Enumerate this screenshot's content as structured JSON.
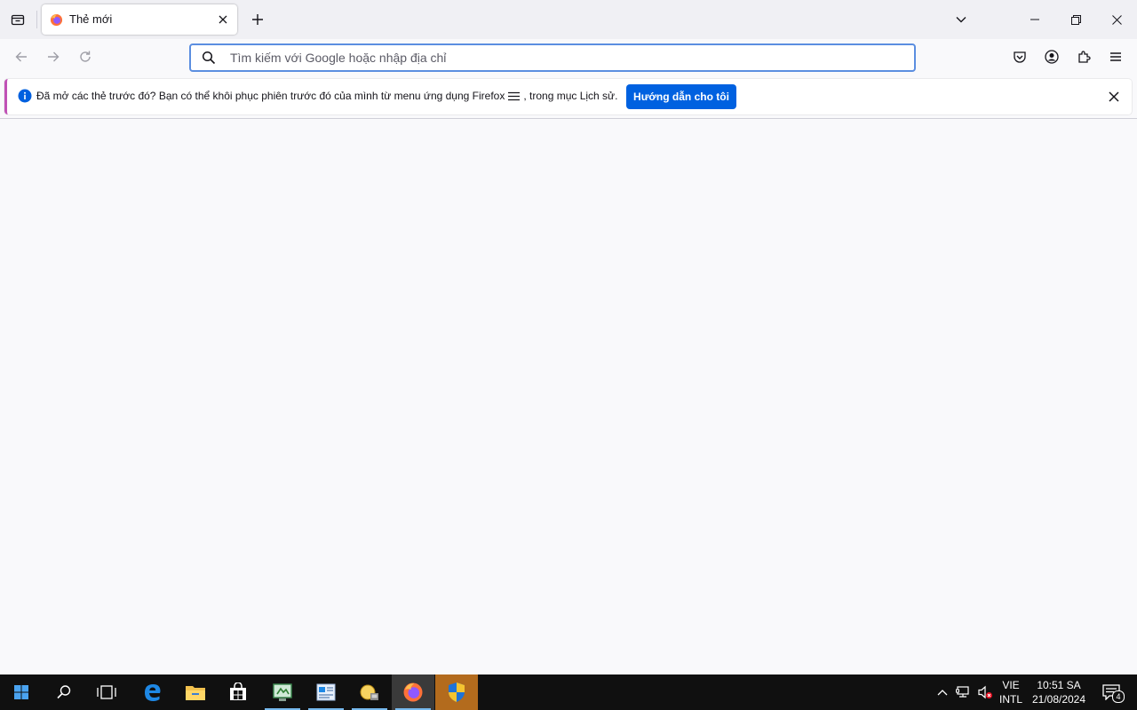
{
  "browser": {
    "tab": {
      "title": "Thẻ mới",
      "favicon": "firefox-icon"
    },
    "toolbar": {
      "tab_list_icon": "firefox-view-icon",
      "new_tab_icon": "plus-icon",
      "list_all_tabs_icon": "chevron-down-icon"
    },
    "window_controls": [
      "minimize-icon",
      "restore-icon",
      "close-icon"
    ],
    "navigation": {
      "back_icon": "arrow-left-icon",
      "forward_icon": "arrow-right-icon",
      "reload_icon": "reload-icon"
    },
    "urlbar": {
      "placeholder": "Tìm kiếm với Google hoặc nhập địa chỉ",
      "value": ""
    },
    "nav_right_icons": [
      "pocket-icon",
      "account-icon",
      "extensions-icon",
      "app-menu-icon"
    ]
  },
  "notification": {
    "message_before": "Đã mở các thẻ trước đó? Bạn có thể khôi phục phiên trước đó của mình từ menu ứng dụng Firefox",
    "message_after": ", trong mục Lịch sử.",
    "button_label": "Hướng dẫn cho tôi"
  },
  "taskbar": {
    "items": [
      "start-icon",
      "search-icon",
      "task-view-icon",
      "edge-icon",
      "file-explorer-icon",
      "store-icon",
      "app-icon",
      "app-icon",
      "app-icon",
      "firefox-icon",
      "security-shield-icon"
    ],
    "tray": {
      "language_line1": "VIE",
      "language_line2": "INTL",
      "time": "10:51 SA",
      "date": "21/08/2024",
      "notification_count": "4"
    }
  },
  "colors": {
    "accent": "#0061e0",
    "urlbar_focus": "#5b8ee0",
    "tabstrip_bg": "#f0f0f4",
    "page_bg": "#f9f9fb",
    "taskbar_bg": "#101010"
  }
}
